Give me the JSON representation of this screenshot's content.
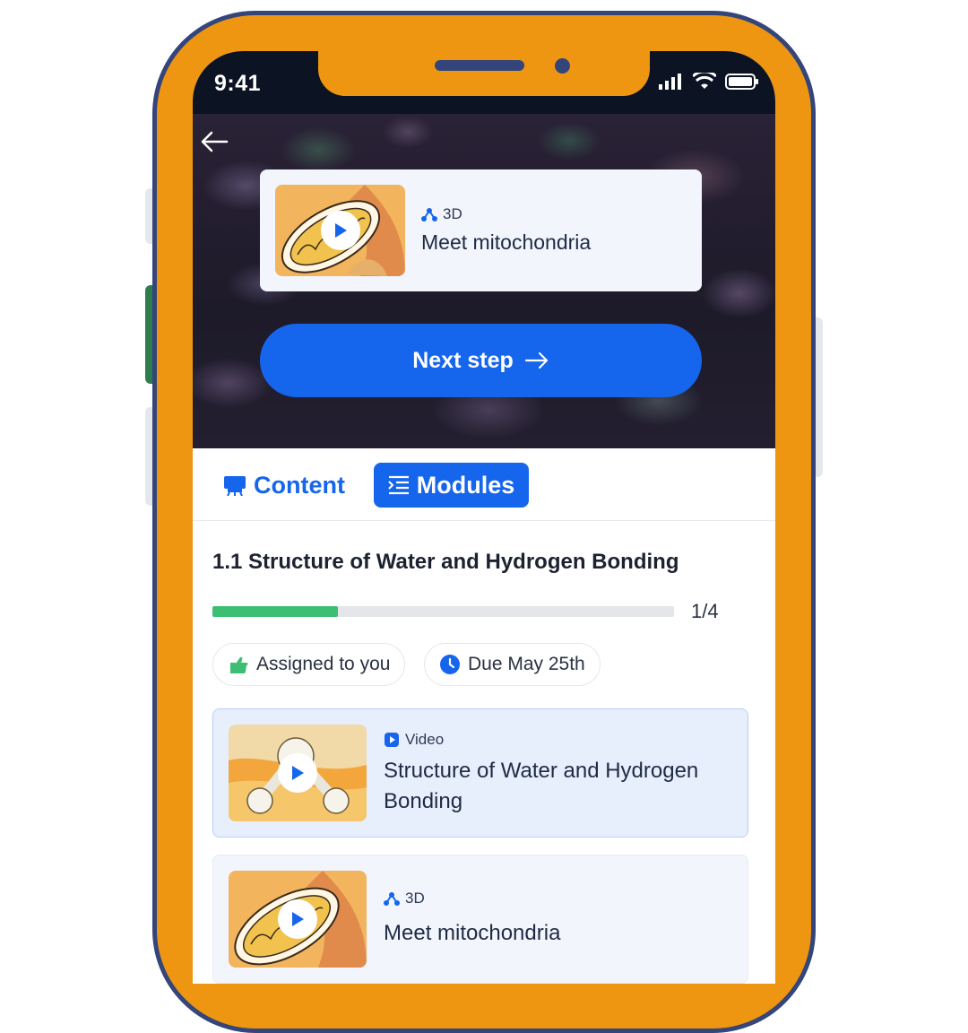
{
  "status_bar": {
    "time": "9:41"
  },
  "hero": {
    "featured": {
      "tag": "3D",
      "title": "Meet mitochondria",
      "tag_icon": "3d-molecule-icon"
    },
    "next_button": "Next step",
    "next_icon": "arrow-right-icon"
  },
  "tabs": [
    {
      "label": "Content",
      "icon": "content-icon",
      "active": false
    },
    {
      "label": "Modules",
      "icon": "list-icon",
      "active": true
    }
  ],
  "module": {
    "title": "1.1 Structure of Water and Hydrogen Bonding",
    "progress": {
      "current": 1,
      "total": 4,
      "label": "1/4",
      "fraction": 0.25
    },
    "chips": [
      {
        "label": "Assigned to you",
        "icon": "assign-hand-icon",
        "icon_color": "#3cbf72"
      },
      {
        "label": "Due May 25th",
        "icon": "clock-icon",
        "icon_color": "#1565ed"
      }
    ]
  },
  "items": [
    {
      "tag": "Video",
      "tag_icon": "video-play-icon",
      "title": "Structure of Water and Hydrogen Bonding",
      "selected": true
    },
    {
      "tag": "3D",
      "tag_icon": "3d-molecule-icon",
      "title": "Meet mitochondria",
      "selected": false
    }
  ],
  "colors": {
    "accent": "#1565ed",
    "phone_frame": "#ee9612",
    "phone_border": "#33457a",
    "progress": "#3cbf72"
  }
}
